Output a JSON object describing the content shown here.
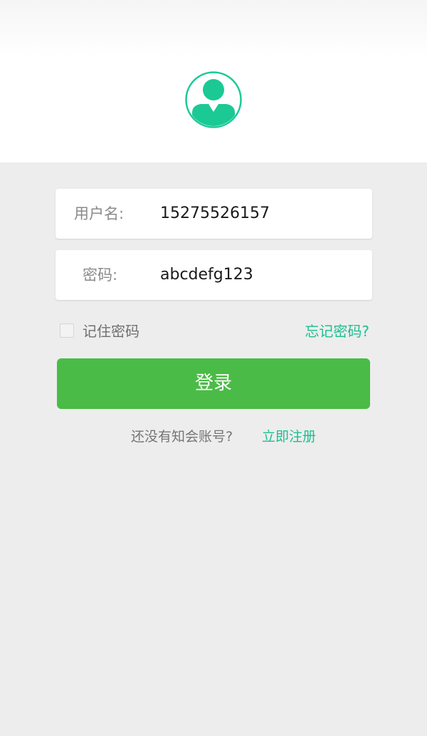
{
  "colors": {
    "accent": "#1bbf8f",
    "login_button": "#4bbb47",
    "background": "#ededed"
  },
  "avatar": {
    "icon": "user-avatar-icon"
  },
  "form": {
    "username_label": "用户名:",
    "username_value": "15275526157",
    "password_label": "密码:",
    "password_value": "abcdefg123"
  },
  "remember": {
    "label": "记住密码",
    "checked": false
  },
  "forgot": {
    "label": "忘记密码?"
  },
  "login": {
    "label": "登录"
  },
  "register": {
    "prompt": "还没有知会账号?",
    "link": "立即注册"
  }
}
